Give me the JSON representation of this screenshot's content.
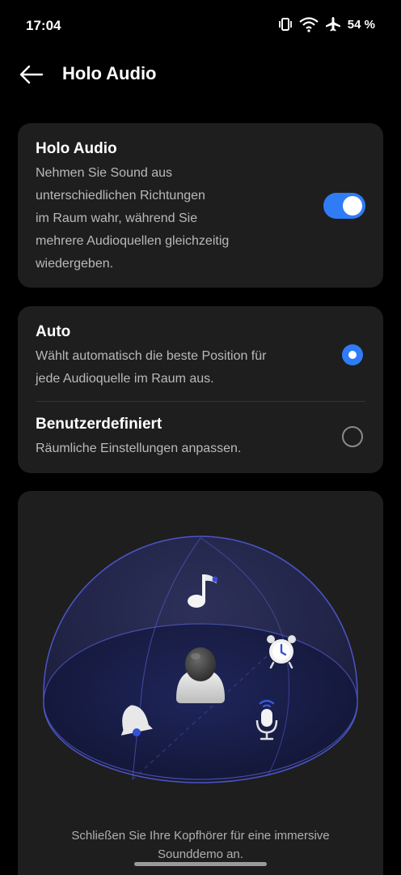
{
  "status": {
    "time": "17:04",
    "battery": "54 %",
    "icons": [
      "vibrate-icon",
      "wifi-icon",
      "airplane-icon"
    ]
  },
  "header": {
    "title": "Holo Audio",
    "back_icon": "arrow-left-icon"
  },
  "holo_card": {
    "title": "Holo Audio",
    "description_lines": [
      "Nehmen Sie Sound aus",
      "unterschiedlichen Richtungen",
      "im Raum wahr, während Sie",
      "mehrere Audioquellen gleichzeitig",
      "wiedergeben."
    ],
    "toggle_on": true
  },
  "mode_card": {
    "options": [
      {
        "title": "Auto",
        "description_lines": [
          "Wählt automatisch die beste Position für",
          "jede Audioquelle im Raum aus."
        ],
        "selected": true
      },
      {
        "title": "Benutzerdefiniert",
        "description_lines": [
          "Räumliche Einstellungen anpassen."
        ],
        "selected": false
      }
    ]
  },
  "demo_card": {
    "icons": [
      "music-note-icon",
      "alarm-clock-icon",
      "user-avatar-icon",
      "bell-icon",
      "microphone-icon"
    ],
    "caption_lines": [
      "Schließen Sie Ihre Kopfhörer für eine immersive",
      "Sounddemo an."
    ]
  },
  "colors": {
    "accent": "#2f7cf6",
    "card_bg": "#1e1e1e",
    "background": "#000000"
  }
}
